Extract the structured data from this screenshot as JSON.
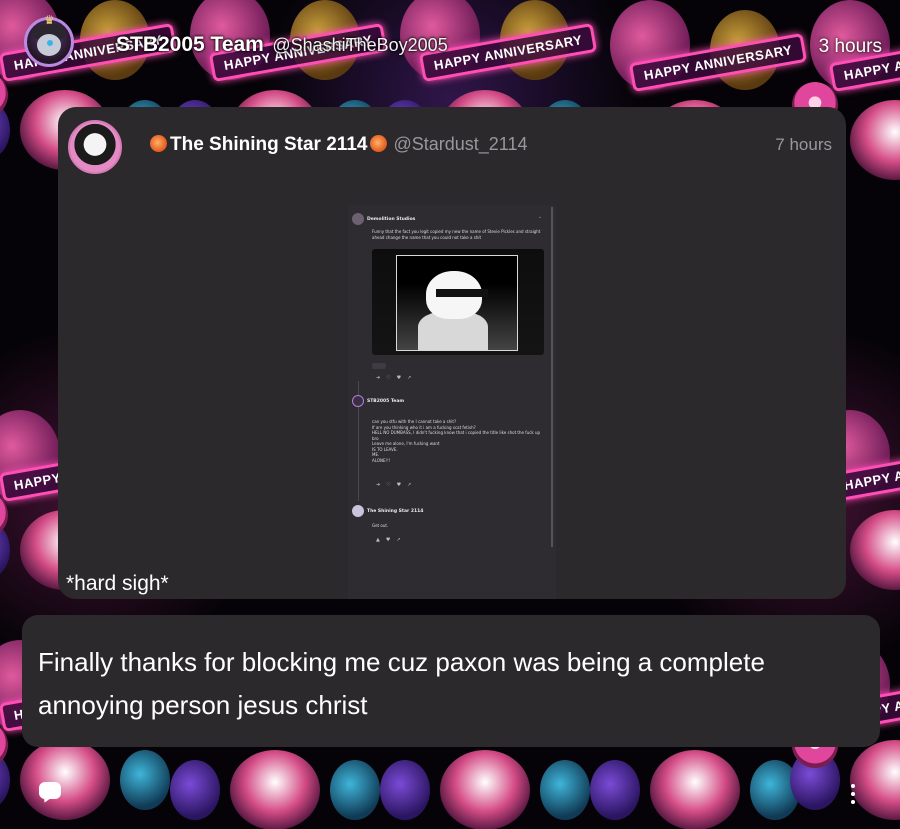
{
  "post": {
    "author_name": "STB2005 Team",
    "author_handle": "@ShashiTheBoy2005",
    "time": "3 hours",
    "body": "Finally thanks for blocking me cuz paxon was being a complete annoying person jesus christ"
  },
  "quoted_post": {
    "author_name": "The Shining Star 2114",
    "author_handle": "@Stardust_2114",
    "time": "7 hours",
    "caption": "*hard sigh*",
    "screenshot": {
      "first_author": "Demolition Studios",
      "first_text": "Funny that the fact you legit copied my new the name of Stevie Pickles and straight ahead change the name that you could not take a shit",
      "second_author": "STB2005 Team",
      "second_text": "can you stfu with the I cannot take a shit?\nIf are you thinking who it i am a fucking scat fetish?\nHELL NO DUMBASS, I didn't fucking know that i copied the title like shot the fuck up bro\nLeave me alone, I'm fucking want\nIS TO LEAVE.\nME.\nALONE!!!",
      "third_author": "The Shining Star 2114",
      "third_text": "Get out."
    }
  },
  "wallpaper": {
    "sign_text": "HAPPY ANNIVERSARY"
  },
  "icons": {
    "comment": "comment-icon",
    "more": "more-vertical-icon",
    "crown": "crown-icon"
  }
}
